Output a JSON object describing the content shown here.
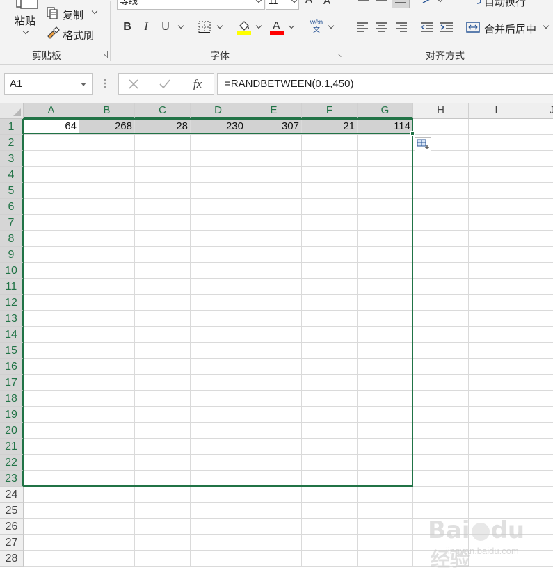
{
  "ribbon": {
    "clipboard": {
      "paste_label": "粘贴",
      "copy_label": "复制",
      "format_painter_label": "格式刷",
      "group_label": "剪贴板"
    },
    "font": {
      "font_name": "等线",
      "font_size": "11",
      "bold_label": "B",
      "italic_label": "I",
      "underline_label": "U",
      "font_color_glyph": "A",
      "phonetic_top": "wén",
      "phonetic_bottom": "文",
      "group_label": "字体",
      "fill_color": "#ffff00",
      "font_color": "#ff0000"
    },
    "alignment": {
      "wrap_text_label": "自动换行",
      "merge_center_label": "合并后居中",
      "group_label": "对齐方式"
    }
  },
  "formula_bar": {
    "name_box": "A1",
    "fx_label": "fx",
    "formula": "=RANDBETWEEN(0.1,450)"
  },
  "sheet": {
    "columns": [
      "A",
      "B",
      "C",
      "D",
      "E",
      "F",
      "G",
      "H",
      "I",
      "J"
    ],
    "rows": [
      "1",
      "2",
      "3",
      "4",
      "5",
      "6",
      "7",
      "8",
      "9",
      "10",
      "11",
      "12",
      "13",
      "14",
      "15",
      "16",
      "17",
      "18",
      "19",
      "20",
      "21",
      "22",
      "23",
      "24",
      "25",
      "26",
      "27",
      "28"
    ],
    "row1_values": [
      "64",
      "268",
      "28",
      "230",
      "307",
      "21",
      "114"
    ],
    "selection": "A1:G23",
    "accent_color": "#217346"
  },
  "watermark": {
    "brand": "Bai",
    "brand_tail": "du",
    "cn_label": "经验",
    "url": "jingyan.baidu.com"
  }
}
